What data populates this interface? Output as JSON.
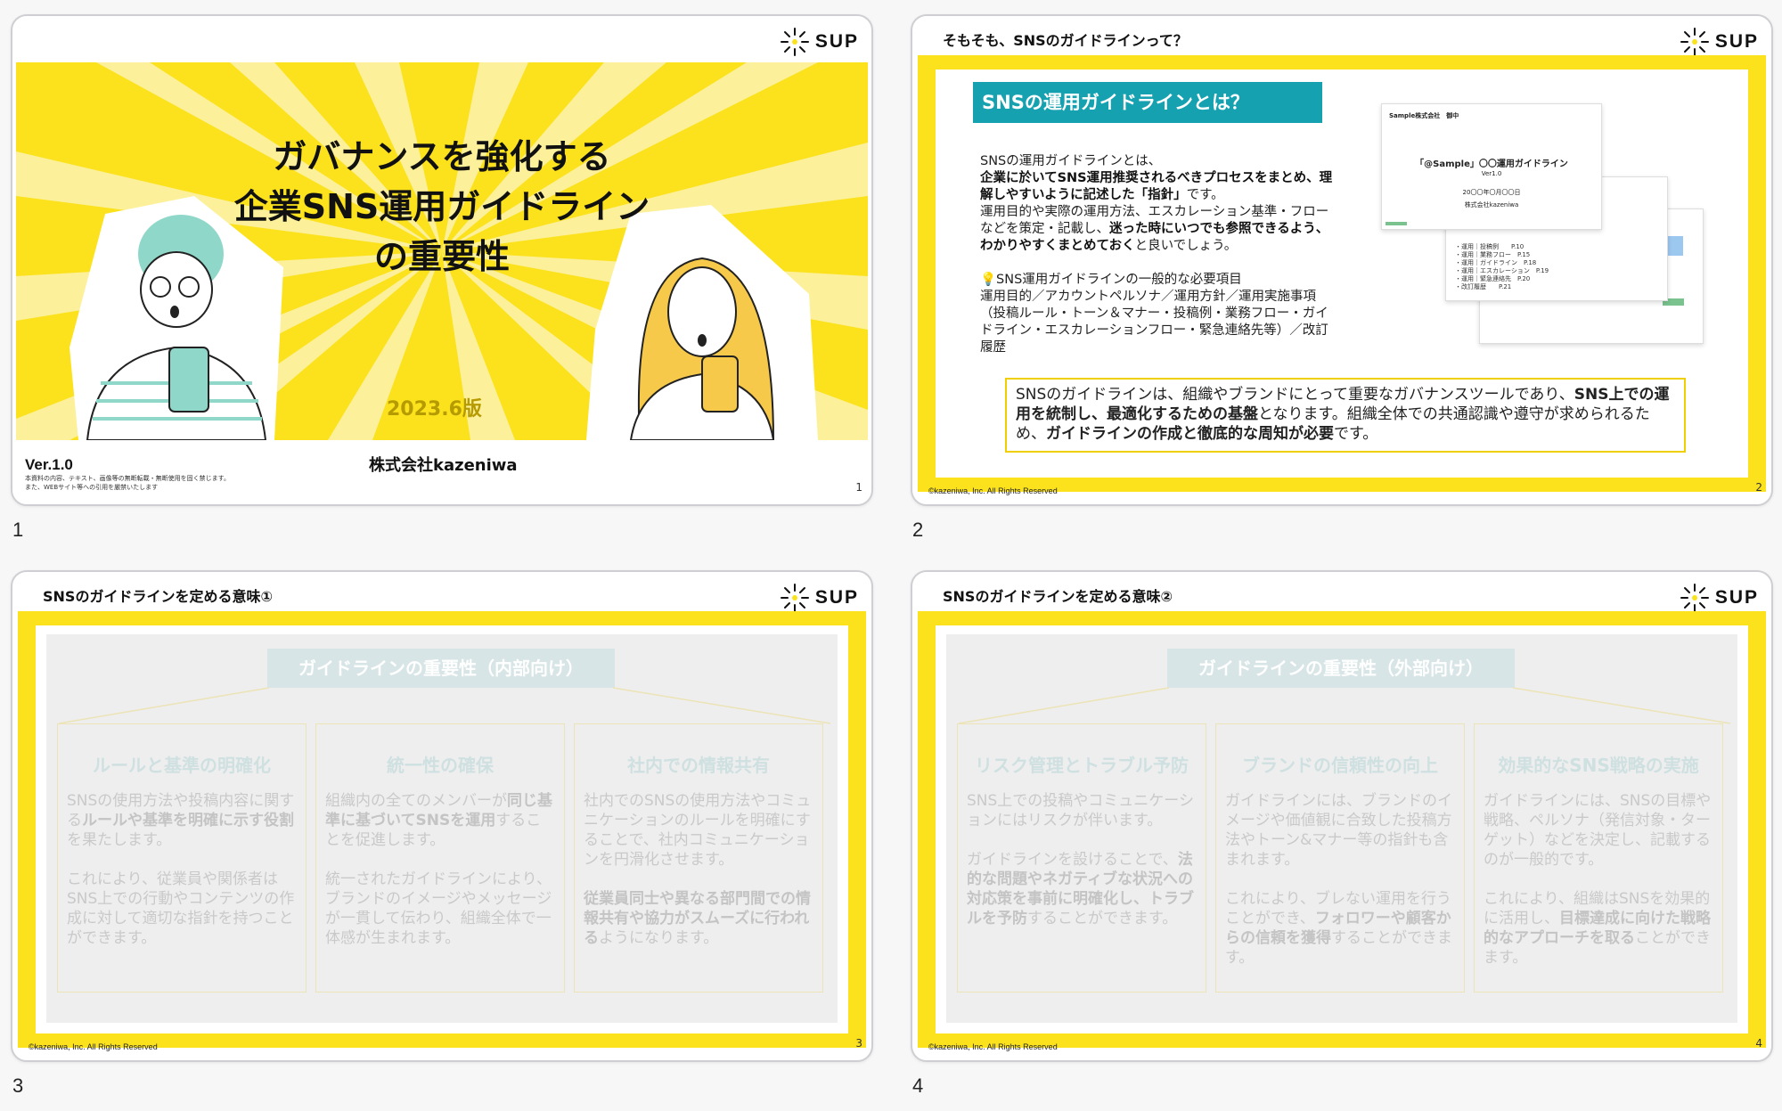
{
  "slide_numbers": [
    "1",
    "2",
    "3",
    "4"
  ],
  "logo": {
    "text": "SUP"
  },
  "colors": {
    "accent_yellow": "#fbe21d",
    "teal": "#16a1b0"
  },
  "slide1": {
    "title_line1": "ガバナンスを強化する",
    "title_line2": "企業SNS運用ガイドライン",
    "title_line3": "の重要性",
    "date": "2023.6版",
    "company": "株式会社kazeniwa",
    "version": "Ver.1.0",
    "note_line1": "本資料の内容、テキスト、画像等の無断転載・無断使用を固く禁じます。",
    "note_line2": "また、WEBサイト等への引用を厳禁いたします",
    "page": "1"
  },
  "slide2": {
    "title": "そもそも、SNSのガイドラインって？",
    "heading": "SNSの運用ガイドラインとは？",
    "p1": "SNSの運用ガイドラインとは、",
    "p1_bold": "企業に於いてSNS運用推奨されるべきプロセスをまとめ、理解しやすいように記述した「指針」",
    "p1_end": "です。",
    "p2": "運用目的や実際の運用方法、エスカレーション基準・フローなどを策定・記載し、",
    "p2_bold": "迷った時にいつでも参照できるよう、わかりやすくまとめておく",
    "p2_end": "と良いでしょう。",
    "p3_head": "💡SNS運用ガイドラインの一般的な必要項目",
    "p3": "運用目的／アカウントペルソナ／運用方針／運用実施事項（投稿ルール・トーン＆マナー・投稿例・業務フロー・ガイドライン・エスカレーションフロー・緊急連絡先等）／改訂履歴",
    "box_a": "SNSのガイドラインは、組織やブランドにとって重要なガバナンスツールであり、",
    "box_b": "SNS上での運用を統制し、最適化するための基盤",
    "box_c": "となります。組織全体での共通認識や遵守が求められるため、",
    "box_d": "ガイドラインの作成と徹底的な周知が必要",
    "box_e": "です。",
    "doc_company": "Sample株式会社　御中",
    "doc_title": "「@Sample」〇〇運用ガイドライン",
    "doc_ver": "Ver1.0",
    "doc_date": "20〇〇年〇月〇〇日",
    "doc_author": "株式会社kazeniwa",
    "doc_toc": [
      "・運用｜投稿例　　P.10",
      "・運用｜業務フロー　P.15",
      "・運用｜ガイドライン　P.18",
      "・運用｜エスカレーション　P.19",
      "・運用｜緊急連絡先　P.20",
      "・改訂履歴　　P.21"
    ],
    "copyright": "©kazeniwa, Inc. All Rights Reserved",
    "page": "2"
  },
  "slide3": {
    "title": "SNSのガイドラインを定める意味①",
    "section": "ガイドラインの重要性（内部向け）",
    "cols": [
      {
        "title": "ルールと基準の明確化",
        "a": "SNSの使用方法や投稿内容に関する",
        "b": "ルールや基準を明確に示す役割",
        "c": "を果たします。",
        "d": "これにより、従業員や関係者はSNS上での行動やコンテンツの作成に対して適切な指針を持つことができます。",
        "e": "",
        "f": ""
      },
      {
        "title": "統一性の確保",
        "a": "組織内の全てのメンバーが",
        "b": "同じ基準に基づいてSNSを運用",
        "c": "することを促進します。",
        "d": "統一されたガイドラインにより、ブランドのイメージやメッセージが一貫して伝わり、組織全体で一体感が生まれます。",
        "e": "",
        "f": ""
      },
      {
        "title": "社内での情報共有",
        "a": "社内でのSNSの使用方法やコミュニケーションのルールを明確にすることで、社内コミュニケーションを円滑化させます。",
        "b": "",
        "c": "",
        "d": "",
        "e": "従業員同士や異なる部門間での情報共有や協力がスムーズに行われる",
        "f": "ようになります。"
      }
    ],
    "copyright": "©kazeniwa, Inc. All Rights Reserved",
    "page": "3"
  },
  "slide4": {
    "title": "SNSのガイドラインを定める意味②",
    "section": "ガイドラインの重要性（外部向け）",
    "cols": [
      {
        "title": "リスク管理とトラブル予防",
        "a": "SNS上での投稿やコミュニケーションにはリスクが伴います。",
        "b": "",
        "c": "",
        "d": "ガイドラインを設けることで、",
        "e": "法的な問題やネガティブな状況への対応策を事前に明確化し、トラブルを予防",
        "f": "することができます。"
      },
      {
        "title": "ブランドの信頼性の向上",
        "a": "ガイドラインには、ブランドのイメージや価値観に合致した投稿方法やトーン&マナー等の指針も含まれます。",
        "b": "",
        "c": "",
        "d": "これにより、ブレない運用を行うことができ、",
        "e": "フォロワーや顧客からの信頼を獲得",
        "f": "することができます。"
      },
      {
        "title": "効果的なSNS戦略の実施",
        "a": "ガイドラインには、SNSの目標や戦略、ペルソナ（発信対象・ターゲット）などを決定し、記載するのが一般的です。",
        "b": "",
        "c": "",
        "d": "これにより、組織はSNSを効果的に活用し、",
        "e": "目標達成に向けた戦略的なアプローチを取る",
        "f": "ことができます。"
      }
    ],
    "copyright": "©kazeniwa, Inc. All Rights Reserved",
    "page": "4"
  }
}
